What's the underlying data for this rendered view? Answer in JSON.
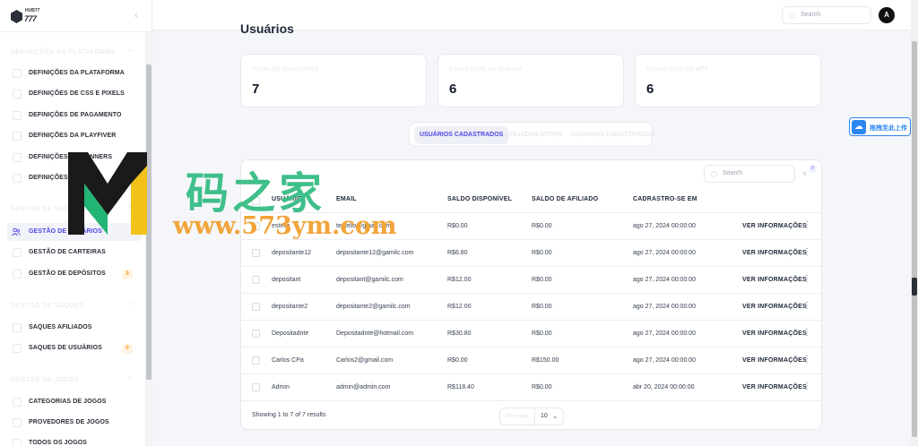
{
  "logo": {
    "line1": "HUB77",
    "line2": "777"
  },
  "header": {
    "search_placeholder": "Search",
    "avatar_initial": "A"
  },
  "sidebar": {
    "sections": [
      {
        "title": "Definições da Plataforma",
        "items": [
          {
            "label": "DEFINIÇÕES DA PLATAFORMA"
          },
          {
            "label": "DEFINIÇÕES DE CSS E PIXELS"
          },
          {
            "label": "DEFINIÇÕES DE PAGAMENTO"
          },
          {
            "label": "DEFINIÇÕES DA PLAYFIVER"
          },
          {
            "label": "DEFINIÇÕES DE BANNERS"
          },
          {
            "label": "DEFINIÇÕES DE JOGOS"
          }
        ]
      },
      {
        "title": "Gestão de Usuários",
        "items": [
          {
            "label": "GESTÃO DE USUÁRIOS",
            "active": true
          },
          {
            "label": "GESTÃO DE CARTEIRAS"
          },
          {
            "label": "GESTÃO DE DEPÓSITOS",
            "badge": "0"
          }
        ]
      },
      {
        "title": "Gestão de Saques",
        "items": [
          {
            "label": "SAQUES AFILIADOS"
          },
          {
            "label": "SAQUES DE USUÁRIOS",
            "badge": "0"
          }
        ]
      },
      {
        "title": "Gestão de Jogos",
        "items": [
          {
            "label": "CATEGORIAS DE JOGOS"
          },
          {
            "label": "PROVEDORES DE JOGOS"
          },
          {
            "label": "TODOS OS JOGOS"
          }
        ]
      }
    ]
  },
  "page": {
    "title": "Usuários"
  },
  "stats": [
    {
      "label": "Total de Cadastros",
      "value": "7"
    },
    {
      "label": "Cadastros da Semana",
      "value": "6"
    },
    {
      "label": "Cadastros do Mês",
      "value": "6"
    }
  ],
  "tabs": [
    "USUÁRIOS CADASTRADOS",
    "AFILIADOS ATIVOS",
    "USUÁRIOS CADASTRADOS"
  ],
  "table": {
    "search_placeholder": "Search",
    "filter_count": "0",
    "columns": [
      "USUÁRIO",
      "EMAIL",
      "SALDO DISPONÍVEL",
      "SALDO DE AFILIADO",
      "CADRASTRO-SE EM"
    ],
    "action_label": "VER INFORMAÇÕES",
    "rows": [
      {
        "name": "estelio",
        "email": "testelio@gmail.com",
        "saldo": "R$0.00",
        "afiliado": "R$0.00",
        "data": "ago 27, 2024 00:00:00"
      },
      {
        "name": "depositante12",
        "email": "depositante12@gamilc.com",
        "saldo": "R$6.80",
        "afiliado": "R$0.00",
        "data": "ago 27, 2024 00:00:00"
      },
      {
        "name": "depositant",
        "email": "depositant@gamilc.com",
        "saldo": "R$12.00",
        "afiliado": "R$0.00",
        "data": "ago 27, 2024 00:00:00"
      },
      {
        "name": "depositante2",
        "email": "depositante2@gamilc.com",
        "saldo": "R$12.00",
        "afiliado": "R$0.00",
        "data": "ago 27, 2024 00:00:00"
      },
      {
        "name": "Depositadnte",
        "email": "Depositadnte@hotmail.com",
        "saldo": "R$30.80",
        "afiliado": "R$0.00",
        "data": "ago 27, 2024 00:00:00"
      },
      {
        "name": "Carlos CPa",
        "email": "Carlos2@gmail.com",
        "saldo": "R$0.00",
        "afiliado": "R$150.00",
        "data": "ago 27, 2024 00:00:00"
      },
      {
        "name": "Admin",
        "email": "admin@admin.com",
        "saldo": "R$118.40",
        "afiliado": "R$0.00",
        "data": "abr 20, 2024 00:00:00"
      }
    ],
    "footer_text": "Showing 1 to 7 of 7 results",
    "per_page_label": "Per page",
    "per_page_value": "10"
  },
  "upload_widget": {
    "label": "拖拽至此上传"
  },
  "watermark": {
    "letter": "M",
    "chinese": "码之家",
    "url": "www.573ym.com"
  },
  "colors": {
    "accent": "#4f46e5",
    "badge": "#f59e0b",
    "upload": "#2c87f0",
    "wm_green": "#3fbf8a",
    "wm_orange": "#f2a43a"
  }
}
